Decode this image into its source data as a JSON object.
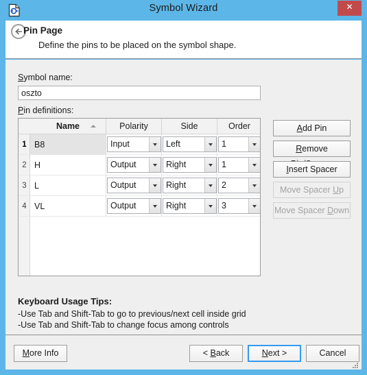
{
  "window": {
    "title": "Symbol Wizard",
    "icon": "symbol-document-icon",
    "close_label": "✕",
    "border_color": "#5CB6E8",
    "close_color": "#C14B4B"
  },
  "header": {
    "back_icon": "back-arrow-icon",
    "page_title": "Pin Page",
    "subtitle": "Define the pins to be placed on the symbol shape."
  },
  "form": {
    "symbol_name_label": "Symbol name:",
    "symbol_name_label_accel": "S",
    "symbol_name_label_rest": "ymbol name:",
    "symbol_name_value": "oszto",
    "symbol_name_placeholder": "",
    "pin_definitions_label_accel": "P",
    "pin_definitions_label_rest": "in definitions:"
  },
  "grid": {
    "columns": [
      "Name",
      "Polarity",
      "Side",
      "Order"
    ],
    "sorted_column": "Name",
    "sort_direction": "ascending",
    "selected_row": 1,
    "rows": [
      {
        "num": "1",
        "name": "B8",
        "polarity": "Input",
        "side": "Left",
        "order": "1"
      },
      {
        "num": "2",
        "name": "H",
        "polarity": "Output",
        "side": "Right",
        "order": "1"
      },
      {
        "num": "3",
        "name": "L",
        "polarity": "Output",
        "side": "Right",
        "order": "2"
      },
      {
        "num": "4",
        "name": "VL",
        "polarity": "Output",
        "side": "Right",
        "order": "3"
      }
    ],
    "polarity_options": [
      "Input",
      "Output"
    ],
    "side_options": [
      "Left",
      "Right"
    ],
    "order_options": [
      "1",
      "2",
      "3"
    ]
  },
  "side_buttons": [
    {
      "accel": "A",
      "rest": "dd Pin",
      "pre": "",
      "enabled": true
    },
    {
      "accel": "R",
      "rest": "emove Pin/Spacer",
      "pre": "",
      "enabled": true
    },
    {
      "accel": "I",
      "rest": "nsert Spacer",
      "pre": "",
      "enabled": true
    },
    {
      "accel": "U",
      "rest": "p",
      "pre": "Move Spacer ",
      "enabled": false
    },
    {
      "accel": "D",
      "rest": "own",
      "pre": "Move Spacer ",
      "enabled": false
    }
  ],
  "tips": {
    "title": "Keyboard Usage Tips:",
    "lines": [
      "-Use Tab and Shift-Tab to go to previous/next cell inside grid",
      "-Use Tab and Shift-Tab to change focus among controls"
    ]
  },
  "footer": {
    "more_info": {
      "accel": "M",
      "rest": "ore Info",
      "pre": ""
    },
    "back": {
      "accel": "B",
      "rest": "ack",
      "pre": "< "
    },
    "next": {
      "accel": "N",
      "rest": "ext >",
      "pre": ""
    },
    "cancel": {
      "accel": "",
      "rest": "Cancel",
      "pre": ""
    },
    "default_button": "Next >"
  }
}
